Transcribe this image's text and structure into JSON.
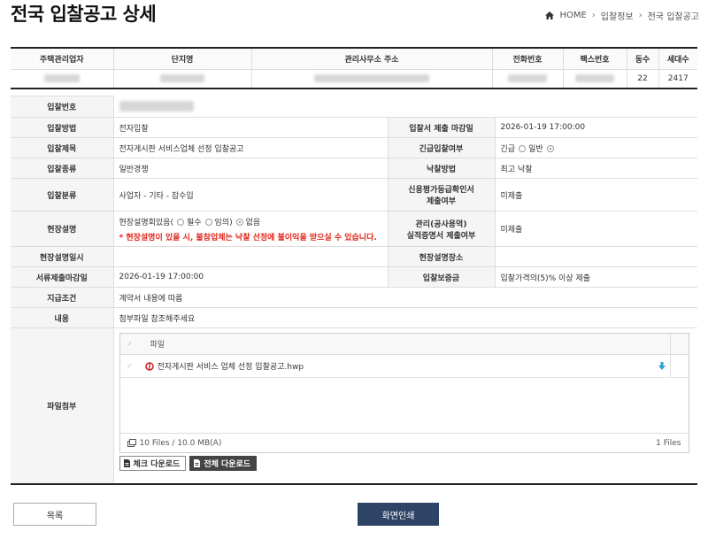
{
  "page": {
    "title": "전국 입찰공고 상세"
  },
  "breadcrumb": {
    "home": "HOME",
    "level1": "입찰정보",
    "level2": "전국 입찰공고"
  },
  "summary": {
    "headers": [
      "주택관리업자",
      "단지명",
      "관리사무소 주소",
      "전화번호",
      "팩스번호",
      "동수",
      "세대수"
    ],
    "dong_count": "22",
    "household_count": "2417"
  },
  "detail": {
    "bid_number_label": "입찰번호",
    "method_label": "입찰방법",
    "method_value": "전자입찰",
    "deadline_label": "입찰서 제출 마감일",
    "deadline_value": "2026-01-19 17:00:00",
    "title_label": "입찰제목",
    "title_value": "전자게시판 서비스업체 선정 입찰공고",
    "urgent_label": "긴급입찰여부",
    "urgent_opt1": "긴급",
    "urgent_opt2": "일반",
    "type_label": "입찰종류",
    "type_value": "일반경쟁",
    "award_label": "낙찰방법",
    "award_value": "최고 낙찰",
    "category_label": "입찰분류",
    "category_value": "사업자 - 기타 - 잡수입",
    "credit_label_1": "신용평가등급확인서",
    "credit_label_2": "제출여부",
    "credit_value": "미제출",
    "site_label": "현장설명",
    "site_meeting_text": "현장설명회있음(",
    "site_opt1": "필수",
    "site_opt2": "임의",
    "site_opt3": "없음",
    "site_warning": "* 현장설명이 있을 시, 불참업체는 낙찰 선정에 불이익을 받으실 수 있습니다.",
    "perf_label_1": "관리(공사용역)",
    "perf_label_2": "실적증명서 제출여부",
    "perf_value": "미제출",
    "site_date_label": "현장설명일시",
    "site_place_label": "현장설명장소",
    "doc_deadline_label": "서류제출마감일",
    "doc_deadline_value": "2026-01-19 17:00:00",
    "deposit_label": "입찰보증금",
    "deposit_value": "입찰가격의(5)% 이상 제출",
    "payment_label": "지급조건",
    "payment_value": "계약서 내용에 따름",
    "content_label": "내용",
    "content_value": "첨부파일 참조해주세요",
    "attach_label": "파일첨부"
  },
  "files": {
    "column_header": "파일",
    "items": [
      {
        "name": "전자게시판 서비스 업체 선정 입찰공고.hwp"
      }
    ],
    "summary": "10 Files / 10.0 MB(A)",
    "count_right": "1 Files",
    "check_download": "체크 다운로드",
    "all_download": "전체 다운로드"
  },
  "buttons": {
    "list": "목록",
    "print": "화면인쇄"
  },
  "colors": {
    "print_button": "#2e4466",
    "warning": "#e2231a",
    "download_arrow": "#2a9fd6",
    "hwp_icon": "#c8282d"
  }
}
